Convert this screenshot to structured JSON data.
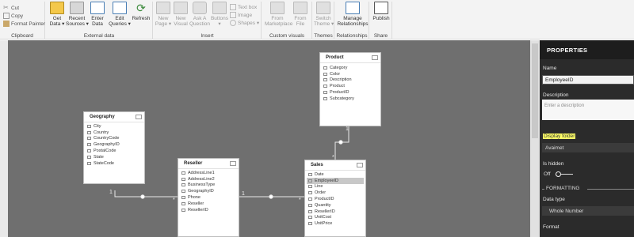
{
  "ribbon": {
    "clipboard": {
      "cut": "Cut",
      "copy": "Copy",
      "format_painter": "Format Painter",
      "group": "Clipboard"
    },
    "external_data": {
      "get_data": [
        "Get",
        "Data ▾"
      ],
      "recent_sources": [
        "Recent",
        "Sources ▾"
      ],
      "enter_data": [
        "Enter",
        "Data"
      ],
      "edit_queries": [
        "Edit",
        "Queries ▾"
      ],
      "refresh": "Refresh",
      "group": "External data"
    },
    "insert": {
      "new_page": [
        "New",
        "Page ▾"
      ],
      "new_visual": [
        "New",
        "Visual"
      ],
      "ask_question": [
        "Ask A",
        "Question"
      ],
      "buttons": "Buttons",
      "text_box": "Text box",
      "image": "Image",
      "shapes": "Shapes ▾",
      "group": "Insert"
    },
    "custom_visuals": {
      "from_marketplace": [
        "From",
        "Marketplace"
      ],
      "from_file": [
        "From",
        "File"
      ],
      "group": "Custom visuals"
    },
    "themes": {
      "switch_theme": [
        "Switch",
        "Theme ▾"
      ],
      "group": "Themes"
    },
    "relationships": {
      "manage": [
        "Manage",
        "Relationships"
      ],
      "group": "Relationships"
    },
    "share": {
      "publish": "Publish",
      "group": "Share"
    }
  },
  "tables": {
    "product": {
      "name": "Product",
      "fields": [
        "Category",
        "Color",
        "Description",
        "Product",
        "ProductID",
        "Subcategory"
      ]
    },
    "geography": {
      "name": "Geography",
      "fields": [
        "City",
        "Country",
        "CountryCode",
        "GeographyID",
        "PostalCode",
        "State",
        "StateCode"
      ]
    },
    "reseller": {
      "name": "Reseller",
      "fields": [
        "AddressLine1",
        "AddressLine2",
        "BusinessType",
        "GeographyID",
        "Phone",
        "Reseller",
        "ResellerID"
      ]
    },
    "sales": {
      "name": "Sales",
      "fields": [
        "Date",
        "EmployeeID",
        "Line",
        "Order",
        "ProductID",
        "Quantity",
        "ResellerID",
        "UnitCost",
        "UnitPrice"
      ],
      "selected_field": "EmployeeID"
    }
  },
  "relationships": {
    "one_label": "1",
    "many_label": "*"
  },
  "properties": {
    "title": "PROPERTIES",
    "name_label": "Name",
    "name_value": "EmployeeID",
    "description_label": "Description",
    "description_placeholder": "Enter a description",
    "display_folder_label": "Display folder",
    "display_folder_value": "Avaimet",
    "is_hidden_label": "Is hidden",
    "is_hidden_value": "Off",
    "formatting_label": "FORMATTING",
    "data_type_label": "Data type",
    "data_type_value": "Whole Number",
    "format_label": "Format"
  },
  "colors": {
    "canvas": "#6f6f6f",
    "pane": "#2b2b2b",
    "highlight": "#ffff66",
    "ribbon": "#f3f3f3"
  }
}
